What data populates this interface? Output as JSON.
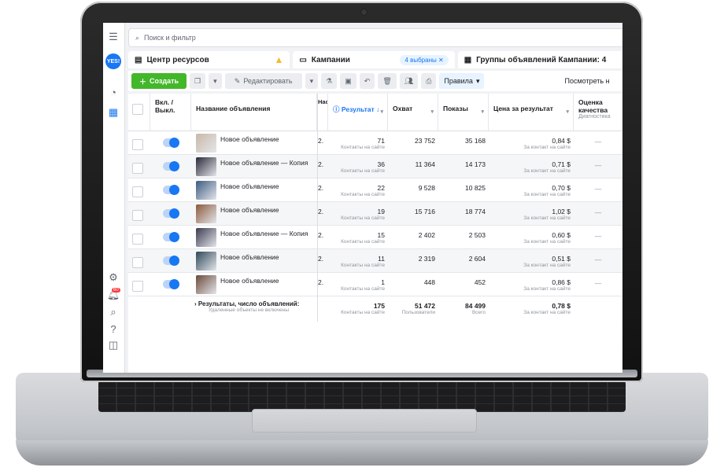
{
  "search": {
    "placeholder": "Поиск и фильтр"
  },
  "sidebar": {
    "logo": "YES!",
    "notification_count": "60"
  },
  "tabs": [
    {
      "label": "Центр ресурсов"
    },
    {
      "label": "Кампании",
      "selected_pill": "4 выбраны"
    },
    {
      "label": "Группы объявлений Кампании: 4"
    }
  ],
  "toolbar": {
    "create_label": "Создать",
    "edit_label": "Редактировать",
    "rules_label": "Правила",
    "view_label": "Посмотреть н"
  },
  "columns": {
    "toggle": "Вкл. / Выкл.",
    "name": "Название объявления",
    "budget": "Нас...атр",
    "result": "Результат",
    "reach": "Охват",
    "impressions": "Показы",
    "cost": "Цена за результат",
    "quality": "Оценка качества",
    "quality_sub": "Диагностика"
  },
  "rows": [
    {
      "name": "Новое объявлениe",
      "trunc": "2.",
      "result": "71",
      "reach": "23 752",
      "impressions": "35 168",
      "cost": "0,84 $"
    },
    {
      "name": "Новое объявление — Копия",
      "trunc": "2.",
      "result": "36",
      "reach": "11 364",
      "impressions": "14 173",
      "cost": "0,71 $"
    },
    {
      "name": "Новое объявление",
      "trunc": "2.",
      "result": "22",
      "reach": "9 528",
      "impressions": "10 825",
      "cost": "0,70 $"
    },
    {
      "name": "Новое объявление",
      "trunc": "2.",
      "result": "19",
      "reach": "15 716",
      "impressions": "18 774",
      "cost": "1,02 $"
    },
    {
      "name": "Новое объявление — Копия",
      "trunc": "2.",
      "result": "15",
      "reach": "2 402",
      "impressions": "2 503",
      "cost": "0,60 $"
    },
    {
      "name": "Новое объявление",
      "trunc": "2.",
      "result": "11",
      "reach": "2 319",
      "impressions": "2 604",
      "cost": "0,51 $"
    },
    {
      "name": "Новое объявлениe",
      "trunc": "2.",
      "result": "1",
      "reach": "448",
      "impressions": "452",
      "cost": "0,86 $"
    }
  ],
  "row_sub": {
    "result": "Контакты на сайте",
    "cost": "За контакт на сайте"
  },
  "totals": {
    "label": "Результаты, число объявлений:",
    "sub": "Удаленные объекты не включены",
    "result": "175",
    "result_sub": "Контакты на сайте",
    "reach": "51 472",
    "reach_sub": "Пользователи",
    "impressions": "84 499",
    "impressions_sub": "Всего",
    "cost": "0,78 $",
    "cost_sub": "За контакт на сайте"
  },
  "colors": {
    "accent": "#1877f2",
    "create": "#42b72a",
    "warning": "#f7b928"
  }
}
